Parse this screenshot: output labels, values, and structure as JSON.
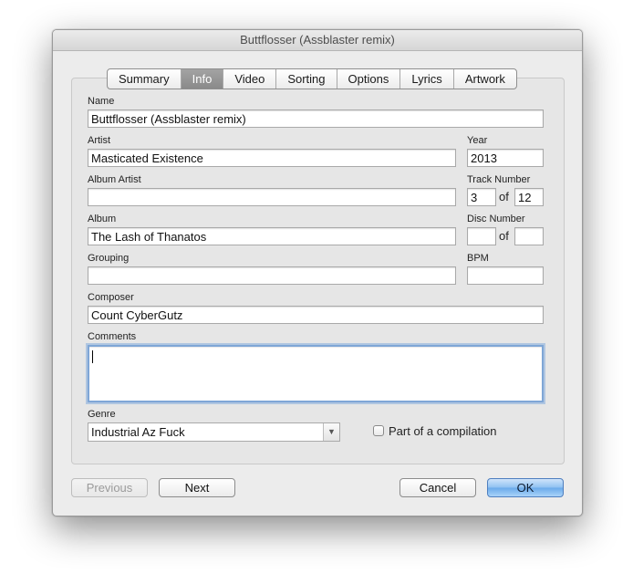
{
  "window": {
    "title": "Buttflosser (Assblaster remix)"
  },
  "tabs": [
    "Summary",
    "Info",
    "Video",
    "Sorting",
    "Options",
    "Lyrics",
    "Artwork"
  ],
  "active_tab": "Info",
  "fields": {
    "name": {
      "label": "Name",
      "value": "Buttflosser (Assblaster remix)"
    },
    "artist": {
      "label": "Artist",
      "value": "Masticated Existence"
    },
    "year": {
      "label": "Year",
      "value": "2013"
    },
    "album_artist": {
      "label": "Album Artist",
      "value": ""
    },
    "track_number": {
      "label": "Track Number",
      "value": "3",
      "of": "of",
      "total": "12"
    },
    "album": {
      "label": "Album",
      "value": "The Lash of Thanatos"
    },
    "disc_number": {
      "label": "Disc Number",
      "value": "",
      "of": "of",
      "total": ""
    },
    "grouping": {
      "label": "Grouping",
      "value": ""
    },
    "bpm": {
      "label": "BPM",
      "value": ""
    },
    "composer": {
      "label": "Composer",
      "value": "Count CyberGutz"
    },
    "comments": {
      "label": "Comments",
      "value": ""
    },
    "genre": {
      "label": "Genre",
      "value": "Industrial Az Fuck"
    },
    "compilation": {
      "label": "Part of a compilation",
      "checked": false
    }
  },
  "buttons": {
    "previous": "Previous",
    "next": "Next",
    "cancel": "Cancel",
    "ok": "OK"
  }
}
